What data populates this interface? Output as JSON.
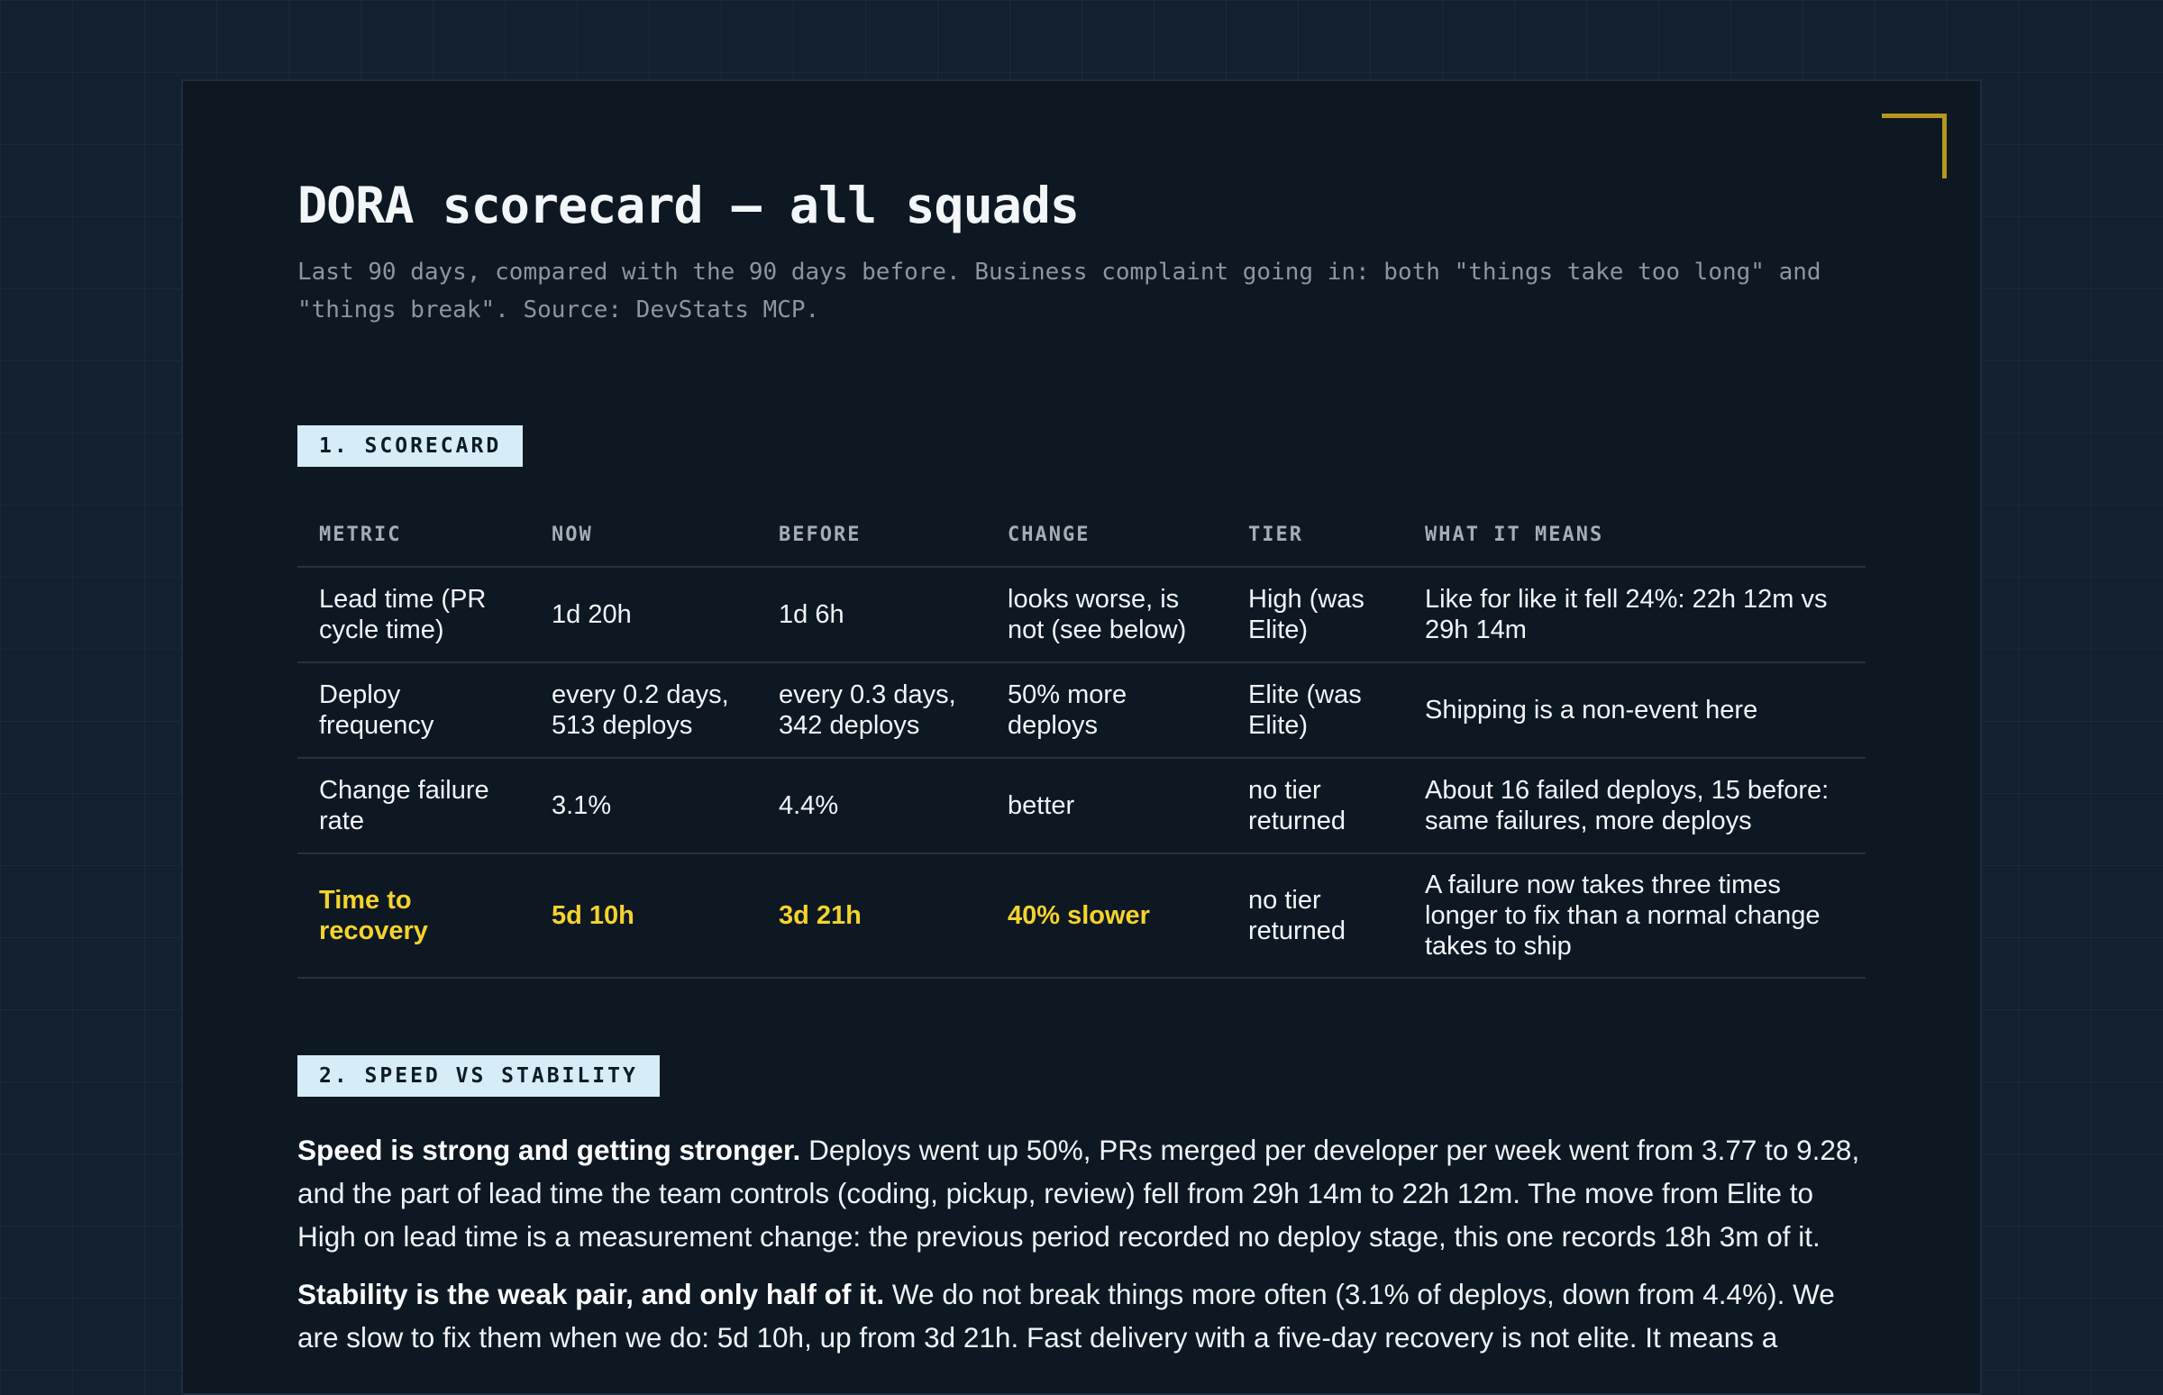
{
  "header": {
    "title": "DORA scorecard — all squads",
    "subtitle": "Last 90 days, compared with the 90 days before. Business complaint going in: both \"things take too long\" and \"things break\". Source: DevStats MCP."
  },
  "sections": [
    {
      "label": "1. SCORECARD"
    },
    {
      "label": "2. SPEED VS STABILITY"
    }
  ],
  "scorecard": {
    "columns": [
      "METRIC",
      "NOW",
      "BEFORE",
      "CHANGE",
      "TIER",
      "WHAT IT MEANS"
    ],
    "rows": [
      {
        "metric": "Lead time (PR cycle time)",
        "now": "1d 20h",
        "before": "1d 6h",
        "change": "looks worse, is not (see below)",
        "tier": "High (was Elite)",
        "meaning": "Like for like it fell 24%: 22h 12m vs 29h 14m"
      },
      {
        "metric": "Deploy frequency",
        "now": "every 0.2 days, 513 deploys",
        "before": "every 0.3 days, 342 deploys",
        "change": "50% more deploys",
        "tier": "Elite (was Elite)",
        "meaning": "Shipping is a non-event here"
      },
      {
        "metric": "Change failure rate",
        "now": "3.1%",
        "before": "4.4%",
        "change": "better",
        "tier": "no tier returned",
        "meaning": "About 16 failed deploys, 15 before: same failures, more deploys"
      },
      {
        "metric": "Time to recovery",
        "now": "5d 10h",
        "before": "3d 21h",
        "change": "40% slower",
        "tier": "no tier returned",
        "meaning": "A failure now takes three times longer to fix than a normal change takes to ship"
      }
    ],
    "highlight_color": "#f4d32c"
  },
  "speed_vs_stability": [
    {
      "lead": "Speed is strong and getting stronger.",
      "body": " Deploys went up 50%, PRs merged per developer per week went from 3.77 to 9.28, and the part of lead time the team controls (coding, pickup, review) fell from 29h 14m to 22h 12m. The move from Elite to High on lead time is a measurement change: the previous period recorded no deploy stage, this one records 18h 3m of it."
    },
    {
      "lead": "Stability is the weak pair, and only half of it.",
      "body": " We do not break things more often (3.1% of deploys, down from 4.4%). We are slow to fix them when we do: 5d 10h, up from 3d 21h. Fast delivery with a five-day recovery is not elite. It means a"
    }
  ],
  "colors": {
    "page_bg": "#13202f",
    "card_bg": "#0e1823",
    "label_bg": "#d6ecf7",
    "corner_accent": "#b8961f"
  }
}
